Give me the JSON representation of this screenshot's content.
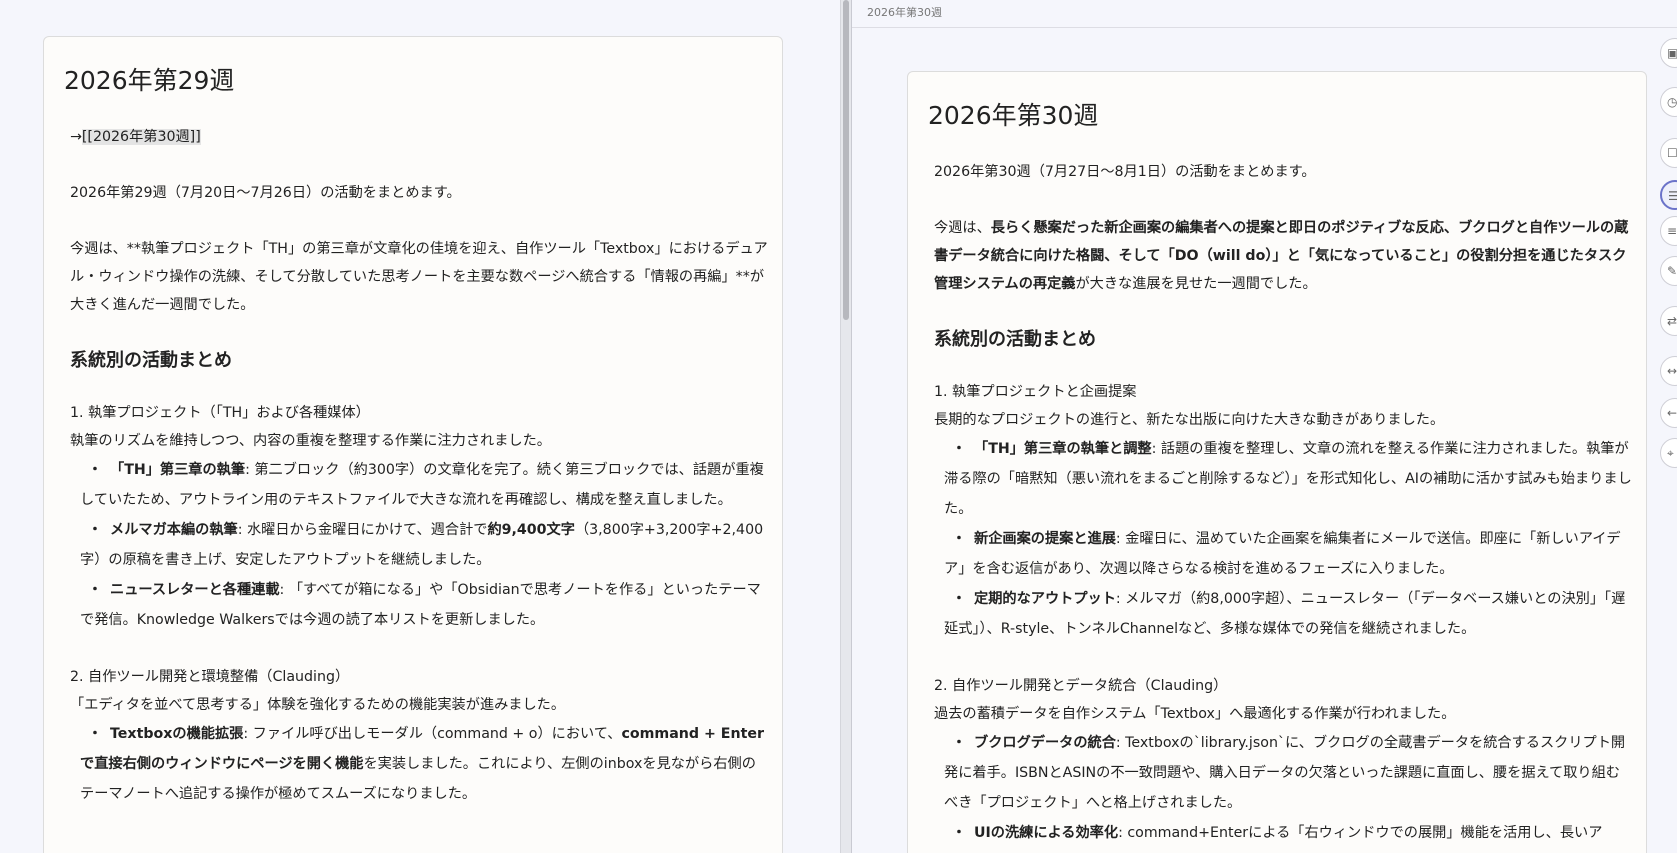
{
  "left": {
    "title": "2026年第29週",
    "link_prefix": "→",
    "link_text": "[[2026年第30週]]",
    "intro": "2026年第29週（7月20日〜7月26日）の活動をまとめます。",
    "summary": "今週は、**執筆プロジェクト「TH」の第三章が文章化の佳境を迎え、自作ツール「Textbox」におけるデュアル・ウィンドウ操作の洗練、そして分散していた思考ノートを主要な数ページへ統合する「情報の再編」**が大きく進んだ一週間でした。",
    "section_heading": "系統別の活動まとめ",
    "s1_title": "1. 執筆プロジェクト（「TH」および各種媒体）",
    "s1_lead": "執筆のリズムを維持しつつ、内容の重複を整理する作業に注力されました。",
    "s1_b1_bold": "「TH」第三章の執筆",
    "s1_b1_text": ": 第二ブロック（約300字）の文章化を完了。続く第三ブロックでは、話題が重複していたため、アウトライン用のテキストファイルで大きな流れを再確認し、構成を整え直しました。",
    "s1_b2_bold": "メルマガ本編の執筆",
    "s1_b2_text1": ": 水曜日から金曜日にかけて、週合計で",
    "s1_b2_bold2": "約9,400文字",
    "s1_b2_text2": "（3,800字+3,200字+2,400字）の原稿を書き上げ、安定したアウトプットを継続しました。",
    "s1_b3_bold": "ニュースレターと各種連載",
    "s1_b3_text": ": 「すべてが箱になる」や「Obsidianで思考ノートを作る」といったテーマで発信。Knowledge Walkersでは今週の読了本リストを更新しました。",
    "s2_title": "2. 自作ツール開発と環境整備（Clauding）",
    "s2_lead": "「エディタを並べて思考する」体験を強化するための機能実装が進みました。",
    "s2_b1_bold": "Textboxの機能拡張",
    "s2_b1_text1": ": ファイル呼び出しモーダル（command + o）において、",
    "s2_b1_bold2": "command + Enterで直接右側のウィンドウにページを開く機能",
    "s2_b1_text2": "を実装しました。これにより、左側のinboxを見ながら右側のテーマノートへ追記する操作が極めてスムーズになりました。",
    "bullet_mark": "・"
  },
  "right": {
    "header_title": "2026年第30週",
    "title": "2026年第30週",
    "intro": "2026年第30週（7月27日〜8月1日）の活動をまとめます。",
    "summary_prefix": "今週は、",
    "summary_bold": "長らく懸案だった新企画案の編集者への提案と即日のポジティブな反応、ブクログと自作ツールの蔵書データ統合に向けた格闘、そして「DO（will do）」と「気になっていること」の役割分担を通じたタスク管理システムの再定義",
    "summary_suffix": "が大きな進展を見せた一週間でした。",
    "section_heading": "系統別の活動まとめ",
    "s1_title": "1. 執筆プロジェクトと企画提案",
    "s1_lead": "長期的なプロジェクトの進行と、新たな出版に向けた大きな動きがありました。",
    "s1_b1_bold": "「TH」第三章の執筆と調整",
    "s1_b1_text": ": 話題の重複を整理し、文章の流れを整える作業に注力されました。執筆が滞る際の「暗黙知（悪い流れをまるごと削除するなど）」を形式知化し、AIの補助に活かす試みも始まりました。",
    "s1_b2_bold": "新企画案の提案と進展",
    "s1_b2_text": ": 金曜日に、温めていた企画案を編集者にメールで送信。即座に「新しいアイデア」を含む返信があり、次週以降さらなる検討を進めるフェーズに入りました。",
    "s1_b3_bold": "定期的なアウトプット",
    "s1_b3_text": ": メルマガ（約8,000字超）、ニュースレター（「データベース嫌いとの決別」「遅延式」）、R-style、トンネルChannelなど、多様な媒体での発信を継続されました。",
    "s2_title": "2. 自作ツール開発とデータ統合（Clauding）",
    "s2_lead": "過去の蓄積データを自作システム「Textbox」へ最適化する作業が行われました。",
    "s2_b1_bold": "ブクログデータの統合",
    "s2_b1_text": ": Textboxの`library.json`に、ブクログの全蔵書データを統合するスクリプト開発に着手。ISBNとASINの不一致問題や、購入日データの欠落といった課題に直面し、腰を据えて取り組むべき「プロジェクト」へと格上げされました。",
    "s2_b2_bold": "UIの洗練による効率化",
    "s2_b2_text": ": command+Enterによる「右ウィンドウでの展開」機能を活用し、長いア",
    "bullet_mark": "・"
  },
  "toolbar": {
    "icons": [
      "camera-icon",
      "clock-icon",
      "square-icon",
      "list-icon",
      "filter-icon",
      "pen-icon",
      "arrow-icon",
      "link-icon",
      "back-icon",
      "tag-icon"
    ]
  }
}
